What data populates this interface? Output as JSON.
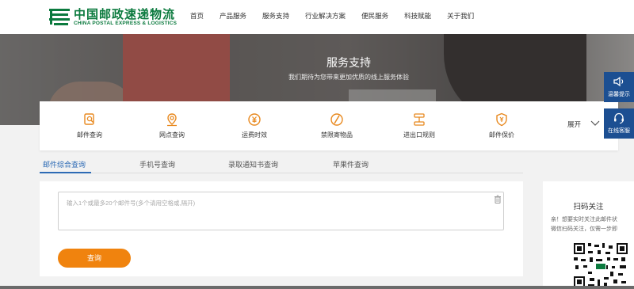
{
  "logo": {
    "cn": "中国邮政速递物流",
    "en": "CHINA POSTAL EXPRESS & LOGISTICS",
    "brand_color": "#0b7a3e"
  },
  "nav": [
    "首页",
    "产品服务",
    "服务支持",
    "行业解决方案",
    "便民服务",
    "科技赋能",
    "关于我们"
  ],
  "banner": {
    "title": "服务支持",
    "subtitle": "我们期待为您带来更加优质的线上服务体验"
  },
  "services": [
    {
      "label": "邮件查询",
      "icon": "search-doc-icon"
    },
    {
      "label": "网点查询",
      "icon": "location-pin-icon"
    },
    {
      "label": "运费时效",
      "icon": "yuan-coin-icon"
    },
    {
      "label": "禁限寄物品",
      "icon": "forbidden-icon"
    },
    {
      "label": "进出口规则",
      "icon": "rules-icon"
    },
    {
      "label": "邮件保价",
      "icon": "shield-yuan-icon"
    }
  ],
  "expand_label": "展开",
  "side_buttons": [
    {
      "label": "温馨提示",
      "icon": "speaker-icon"
    },
    {
      "label": "在线客服",
      "icon": "headset-icon"
    }
  ],
  "tabs": [
    "邮件综合查询",
    "手机号查询",
    "录取通知书查询",
    "苹果件查询"
  ],
  "active_tab": "邮件综合查询",
  "query": {
    "placeholder": "输入1个或最多20个邮件号(多个请用空格或,隔开)",
    "button": "查询"
  },
  "scan": {
    "title": "扫码关注",
    "desc_line1": "亲！想要实时关注此邮件状",
    "desc_line2": "微信扫码关注，仅需一步即"
  },
  "colors": {
    "accent": "#2d6bb5",
    "button": "#f0830e",
    "side_panel": "#1c4f92",
    "icon_orange": "#e8891f"
  }
}
